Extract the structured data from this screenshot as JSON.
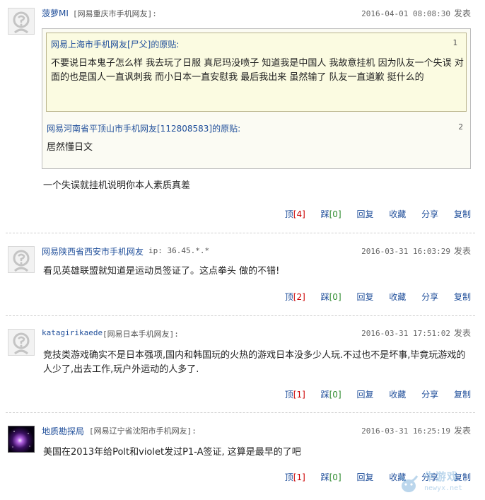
{
  "actions": {
    "up": "顶",
    "down": "踩",
    "reply": "回复",
    "fav": "收藏",
    "share": "分享",
    "copy": "复制"
  },
  "post_label": "发表",
  "comments": [
    {
      "user": "菠萝MI",
      "location": "[网易重庆市手机网友]:",
      "time": "2016-04-01 08:08:30",
      "quotes": [
        {
          "header": "网易上海市手机网友[尸父]的原贴:",
          "num": "1",
          "text": "不要说日本鬼子怎么样 我去玩了日服 真尼玛没喷子 知道我是中国人 我故意挂机 因为队友一个失误 对面的也是国人一直讽刺我 而小日本一直安慰我 最后我出来 虽然输了 队友一直道歉 挺什么的"
        },
        {
          "header": "网易河南省平顶山市手机网友[112808583]的原贴:",
          "num": "2",
          "text": "居然懂日文"
        }
      ],
      "text": "一个失误就挂机说明你本人素质真差",
      "up_count": "[4]",
      "down_count": "[0]"
    },
    {
      "user": "网易陕西省西安市手机网友",
      "location": "ip: 36.45.*.*",
      "time": "2016-03-31 16:03:29",
      "text": "看见英雄联盟就知道是运动员签证了。这点拳头  做的不错!",
      "up_count": "[2]",
      "down_count": "[0]"
    },
    {
      "user": "katagirikaede",
      "location": "[网易日本手机网友]:",
      "time": "2016-03-31 17:51:02",
      "text": "竞技类游戏确实不是日本强项,国内和韩国玩的火热的游戏日本没多少人玩.不过也不是坏事,毕竟玩游戏的人少了,出去工作,玩户外运动的人多了.",
      "up_count": "[1]",
      "down_count": "[0]"
    },
    {
      "user": "地质勘探局",
      "location": "[网易辽宁省沈阳市手机网友]:",
      "time": "2016-03-31 16:25:19",
      "text": "美国在2013年给Polt和violet发过P1-A签证, 这算是最早的了吧",
      "up_count": "[1]",
      "down_count": "[0]"
    }
  ],
  "watermark": {
    "text": "牛游戏",
    "url": "newyx.net"
  }
}
